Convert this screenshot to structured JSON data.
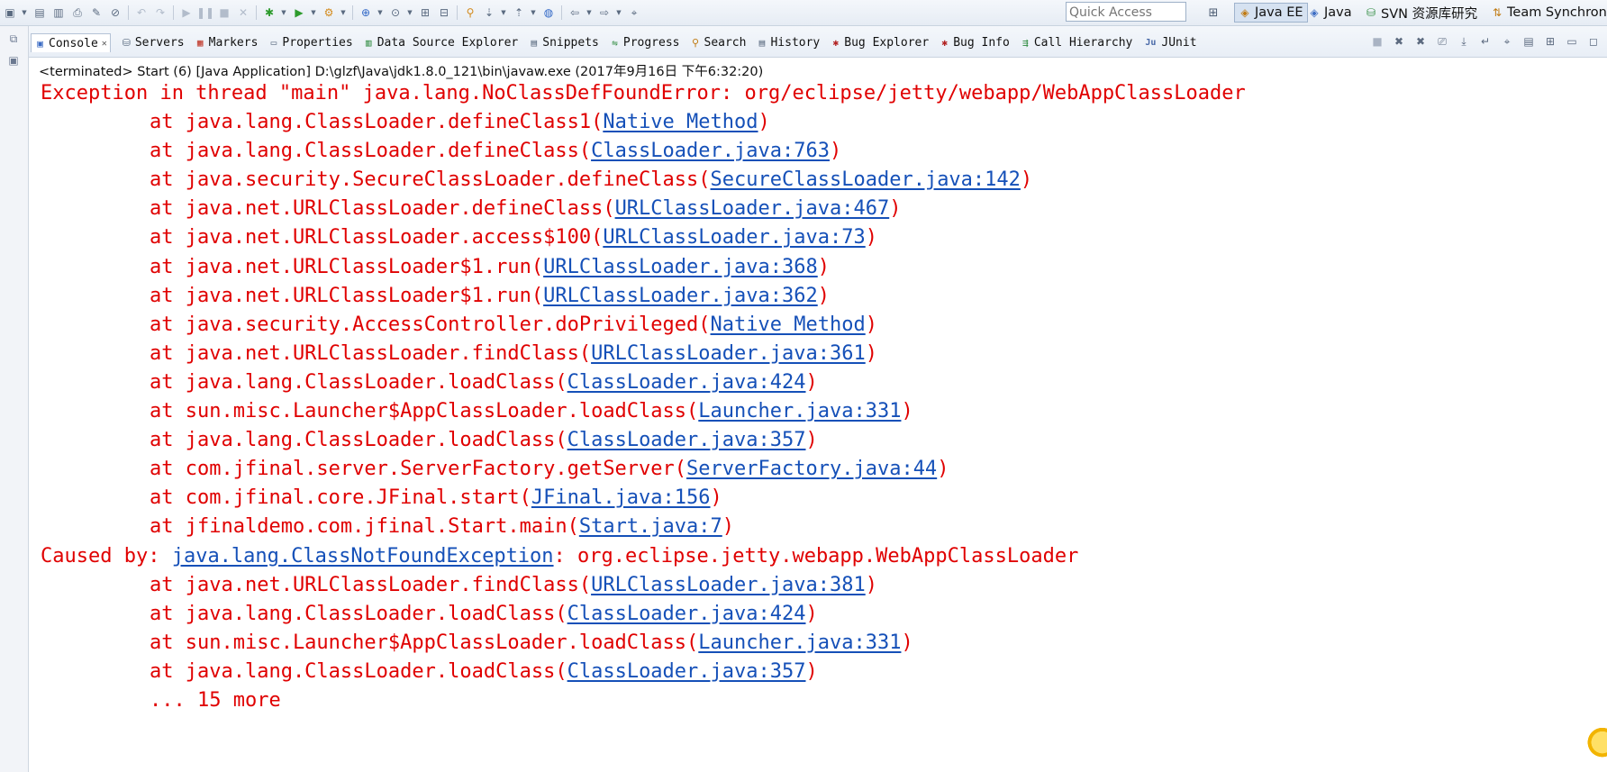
{
  "toolbar": {
    "buttons": [
      {
        "icon": "new-icon",
        "glyph": "▣"
      },
      {
        "icon": "save-icon",
        "glyph": "▤"
      },
      {
        "icon": "save-all-icon",
        "glyph": "▥"
      },
      {
        "icon": "print-icon",
        "glyph": "⎙"
      },
      {
        "icon": "toggle-mark-icon",
        "glyph": "✎"
      },
      {
        "icon": "skip-breakpoints-icon",
        "glyph": "⊘"
      },
      {
        "icon": "undo-icon",
        "glyph": "↶"
      },
      {
        "icon": "redo-icon",
        "glyph": "↷"
      },
      {
        "icon": "resume-icon",
        "glyph": "▶"
      },
      {
        "icon": "suspend-icon",
        "glyph": "❚❚"
      },
      {
        "icon": "terminate-icon",
        "glyph": "■"
      },
      {
        "icon": "disconnect-icon",
        "glyph": "✕"
      },
      {
        "icon": "debug-icon",
        "glyph": "✱"
      },
      {
        "icon": "run-icon",
        "glyph": "▶"
      },
      {
        "icon": "external-tools-icon",
        "glyph": "⚙"
      },
      {
        "icon": "new-server-icon",
        "glyph": "⊕"
      },
      {
        "icon": "new-web-project-icon",
        "glyph": "⊙"
      },
      {
        "icon": "open-type-icon",
        "glyph": "⊞"
      },
      {
        "icon": "open-resource-icon",
        "glyph": "⊟"
      },
      {
        "icon": "search-icon",
        "glyph": "⚲"
      },
      {
        "icon": "next-annotation-icon",
        "glyph": "⇣"
      },
      {
        "icon": "previous-annotation-icon",
        "glyph": "⇡"
      },
      {
        "icon": "globe-icon",
        "glyph": "◍"
      },
      {
        "icon": "back-icon",
        "glyph": "⇦"
      },
      {
        "icon": "forward-icon",
        "glyph": "⇨"
      },
      {
        "icon": "pin-editor-icon",
        "glyph": "⌖"
      }
    ]
  },
  "quick_access": {
    "placeholder": "Quick Access",
    "value": ""
  },
  "perspectives": [
    {
      "label": "Java EE",
      "icon": "java-ee-perspective-icon",
      "active": true
    },
    {
      "label": "Java",
      "icon": "java-perspective-icon",
      "active": false
    },
    {
      "label": "SVN 资源库研究",
      "icon": "svn-perspective-icon",
      "active": false
    },
    {
      "label": "Team Synchroni",
      "icon": "team-sync-perspective-icon",
      "active": false
    }
  ],
  "view_tabs": [
    {
      "label": "Console",
      "icon": "console-icon",
      "active": true,
      "closable": true,
      "color": "#3c6cc4"
    },
    {
      "label": "Servers",
      "icon": "servers-icon",
      "active": false,
      "color": "#5a6b80"
    },
    {
      "label": "Markers",
      "icon": "markers-icon",
      "active": false,
      "color": "#c0392b"
    },
    {
      "label": "Properties",
      "icon": "properties-icon",
      "active": false,
      "color": "#5a6b80"
    },
    {
      "label": "Data Source Explorer",
      "icon": "data-source-icon",
      "active": false,
      "color": "#2d8a3e"
    },
    {
      "label": "Snippets",
      "icon": "snippets-icon",
      "active": false,
      "color": "#5a6b80"
    },
    {
      "label": "Progress",
      "icon": "progress-icon",
      "active": false,
      "color": "#2d8a3e"
    },
    {
      "label": "Search",
      "icon": "search-tab-icon",
      "active": false,
      "color": "#c07a12"
    },
    {
      "label": "History",
      "icon": "history-icon",
      "active": false,
      "color": "#5a6b80"
    },
    {
      "label": "Bug Explorer",
      "icon": "bug-explorer-icon",
      "active": false,
      "color": "#b22222"
    },
    {
      "label": "Bug Info",
      "icon": "bug-info-icon",
      "active": false,
      "color": "#b22222"
    },
    {
      "label": "Call Hierarchy",
      "icon": "call-hierarchy-icon",
      "active": false,
      "color": "#2d8a3e"
    },
    {
      "label": "JUnit",
      "icon": "junit-icon",
      "active": false,
      "color": "#4a6aa8"
    }
  ],
  "console": {
    "header": "<terminated> Start (6) [Java Application] D:\\glzf\\Java\\jdk1.8.0_121\\bin\\javaw.exe (2017年9月16日 下午6:32:20)",
    "lines": [
      {
        "indent": false,
        "prefix": "Exception in thread \"main\" java.lang.NoClassDefFoundError: org/eclipse/jetty/webapp/WebAppClassLoader",
        "link": "",
        "suffix": ""
      },
      {
        "indent": true,
        "prefix": "at java.lang.ClassLoader.defineClass1(",
        "link": "Native Method",
        "suffix": ")"
      },
      {
        "indent": true,
        "prefix": "at java.lang.ClassLoader.defineClass(",
        "link": "ClassLoader.java:763",
        "suffix": ")"
      },
      {
        "indent": true,
        "prefix": "at java.security.SecureClassLoader.defineClass(",
        "link": "SecureClassLoader.java:142",
        "suffix": ")"
      },
      {
        "indent": true,
        "prefix": "at java.net.URLClassLoader.defineClass(",
        "link": "URLClassLoader.java:467",
        "suffix": ")"
      },
      {
        "indent": true,
        "prefix": "at java.net.URLClassLoader.access$100(",
        "link": "URLClassLoader.java:73",
        "suffix": ")"
      },
      {
        "indent": true,
        "prefix": "at java.net.URLClassLoader$1.run(",
        "link": "URLClassLoader.java:368",
        "suffix": ")"
      },
      {
        "indent": true,
        "prefix": "at java.net.URLClassLoader$1.run(",
        "link": "URLClassLoader.java:362",
        "suffix": ")"
      },
      {
        "indent": true,
        "prefix": "at java.security.AccessController.doPrivileged(",
        "link": "Native Method",
        "suffix": ")"
      },
      {
        "indent": true,
        "prefix": "at java.net.URLClassLoader.findClass(",
        "link": "URLClassLoader.java:361",
        "suffix": ")"
      },
      {
        "indent": true,
        "prefix": "at java.lang.ClassLoader.loadClass(",
        "link": "ClassLoader.java:424",
        "suffix": ")"
      },
      {
        "indent": true,
        "prefix": "at sun.misc.Launcher$AppClassLoader.loadClass(",
        "link": "Launcher.java:331",
        "suffix": ")"
      },
      {
        "indent": true,
        "prefix": "at java.lang.ClassLoader.loadClass(",
        "link": "ClassLoader.java:357",
        "suffix": ")"
      },
      {
        "indent": true,
        "prefix": "at com.jfinal.server.ServerFactory.getServer(",
        "link": "ServerFactory.java:44",
        "suffix": ")"
      },
      {
        "indent": true,
        "prefix": "at com.jfinal.core.JFinal.start(",
        "link": "JFinal.java:156",
        "suffix": ")"
      },
      {
        "indent": true,
        "prefix": "at jfinaldemo.com.jfinal.Start.main(",
        "link": "Start.java:7",
        "suffix": ")"
      },
      {
        "indent": false,
        "prefix": "Caused by: ",
        "link": "java.lang.ClassNotFoundException",
        "suffix": ": org.eclipse.jetty.webapp.WebAppClassLoader"
      },
      {
        "indent": true,
        "prefix": "at java.net.URLClassLoader.findClass(",
        "link": "URLClassLoader.java:381",
        "suffix": ")"
      },
      {
        "indent": true,
        "prefix": "at java.lang.ClassLoader.loadClass(",
        "link": "ClassLoader.java:424",
        "suffix": ")"
      },
      {
        "indent": true,
        "prefix": "at sun.misc.Launcher$AppClassLoader.loadClass(",
        "link": "Launcher.java:331",
        "suffix": ")"
      },
      {
        "indent": true,
        "prefix": "at java.lang.ClassLoader.loadClass(",
        "link": "ClassLoader.java:357",
        "suffix": ")"
      },
      {
        "indent": true,
        "prefix": "... 15 more",
        "link": "",
        "suffix": ""
      }
    ],
    "colors": {
      "error": "#e00000",
      "link": "#1550b8"
    }
  }
}
